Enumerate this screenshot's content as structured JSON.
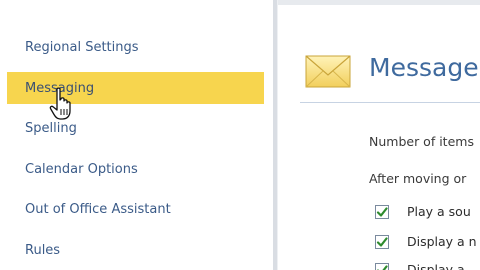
{
  "sidebar": {
    "items": [
      {
        "label": "Regional Settings"
      },
      {
        "label": "Messaging"
      },
      {
        "label": "Spelling"
      },
      {
        "label": "Calendar Options"
      },
      {
        "label": "Out of Office Assistant"
      },
      {
        "label": "Rules"
      }
    ],
    "selected_index": 1,
    "selected_color": "#f7d54e"
  },
  "main": {
    "title": "Message",
    "icon": "envelope-icon",
    "lines": [
      "Number of items",
      "After moving or"
    ],
    "options": [
      {
        "label": "Play a sou",
        "checked": true
      },
      {
        "label": "Display a n",
        "checked": true
      },
      {
        "label": "Display a",
        "checked": true
      }
    ]
  },
  "colors": {
    "accent": "#3f6a9e",
    "link": "#3b5b88",
    "check": "#2e8b2e"
  }
}
